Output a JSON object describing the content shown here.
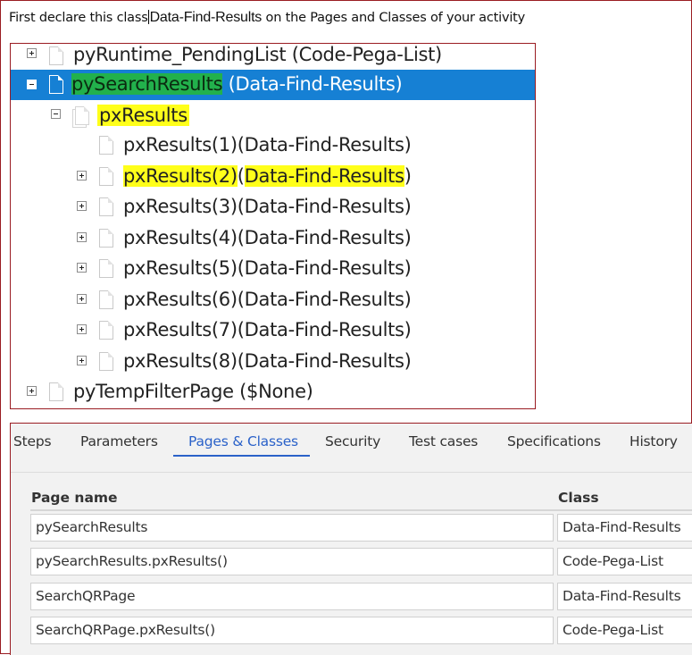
{
  "instruction": {
    "prefix": "First declare this class",
    "class_name": "Data-Find-Results",
    "suffix": " on the Pages and Classes of your activity"
  },
  "tree": {
    "nodes": [
      {
        "label": "pyRuntime_PendingList (Code-Pega-List)"
      },
      {
        "label_part1": "pySearchResults",
        "label_part2": " (Data-Find-Results)"
      },
      {
        "label": "pxResults"
      },
      {
        "label": "pxResults(1)(Data-Find-Results)"
      },
      {
        "label_part1": "pxResults(2)",
        "label_part2": "(",
        "label_part3": "Data-Find-Results",
        "label_part4": ")"
      },
      {
        "label": "pxResults(3)(Data-Find-Results)"
      },
      {
        "label": "pxResults(4)(Data-Find-Results)"
      },
      {
        "label": "pxResults(5)(Data-Find-Results)"
      },
      {
        "label": "pxResults(6)(Data-Find-Results)"
      },
      {
        "label": "pxResults(7)(Data-Find-Results)"
      },
      {
        "label": "pxResults(8)(Data-Find-Results)"
      },
      {
        "label": "pyTempFilterPage ($None)"
      }
    ]
  },
  "tabs": [
    "Steps",
    "Parameters",
    "Pages & Classes",
    "Security",
    "Test cases",
    "Specifications",
    "History"
  ],
  "active_tab": "Pages & Classes",
  "table": {
    "headers": {
      "page_name": "Page name",
      "class": "Class"
    },
    "rows": [
      {
        "page_name": "pySearchResults",
        "class": "Data-Find-Results"
      },
      {
        "page_name": "pySearchResults.pxResults()",
        "class": "Code-Pega-List"
      },
      {
        "page_name": "SearchQRPage",
        "class": "Data-Find-Results"
      },
      {
        "page_name": "SearchQRPage.pxResults()",
        "class": "Code-Pega-List"
      }
    ]
  },
  "colors": {
    "selection": "#1680d4",
    "highlight_green": "#22b14c",
    "highlight_yellow": "#ffff1a",
    "active_tab": "#2b62c9",
    "frame": "#9a1c22"
  }
}
